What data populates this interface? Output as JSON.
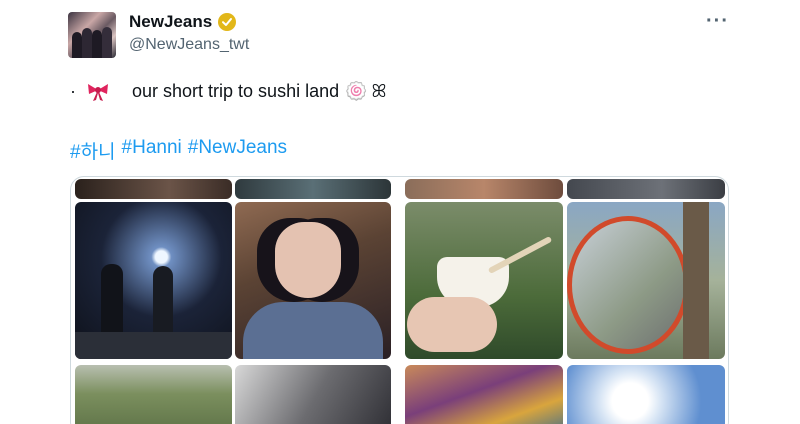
{
  "post": {
    "display_name": "NewJeans",
    "handle": "@NewJeans_twt",
    "more_label": "···",
    "verified_badge": "verified-badge",
    "text": {
      "bullet": "·",
      "body": "our short trip to sushi land",
      "spiral_emoji": "🍥",
      "decoration": "ꕤ"
    },
    "hashtags": [
      "#하니",
      "#Hanni",
      "#NewJeans"
    ],
    "link_color": "#1d9bf0",
    "media": {
      "description_icons": [
        "night-street-photo",
        "selfie-photo",
        "ice-cream-photo",
        "mirror-photo",
        "tree-photo",
        "building-photo",
        "painting-photo",
        "sky-photo"
      ]
    }
  }
}
